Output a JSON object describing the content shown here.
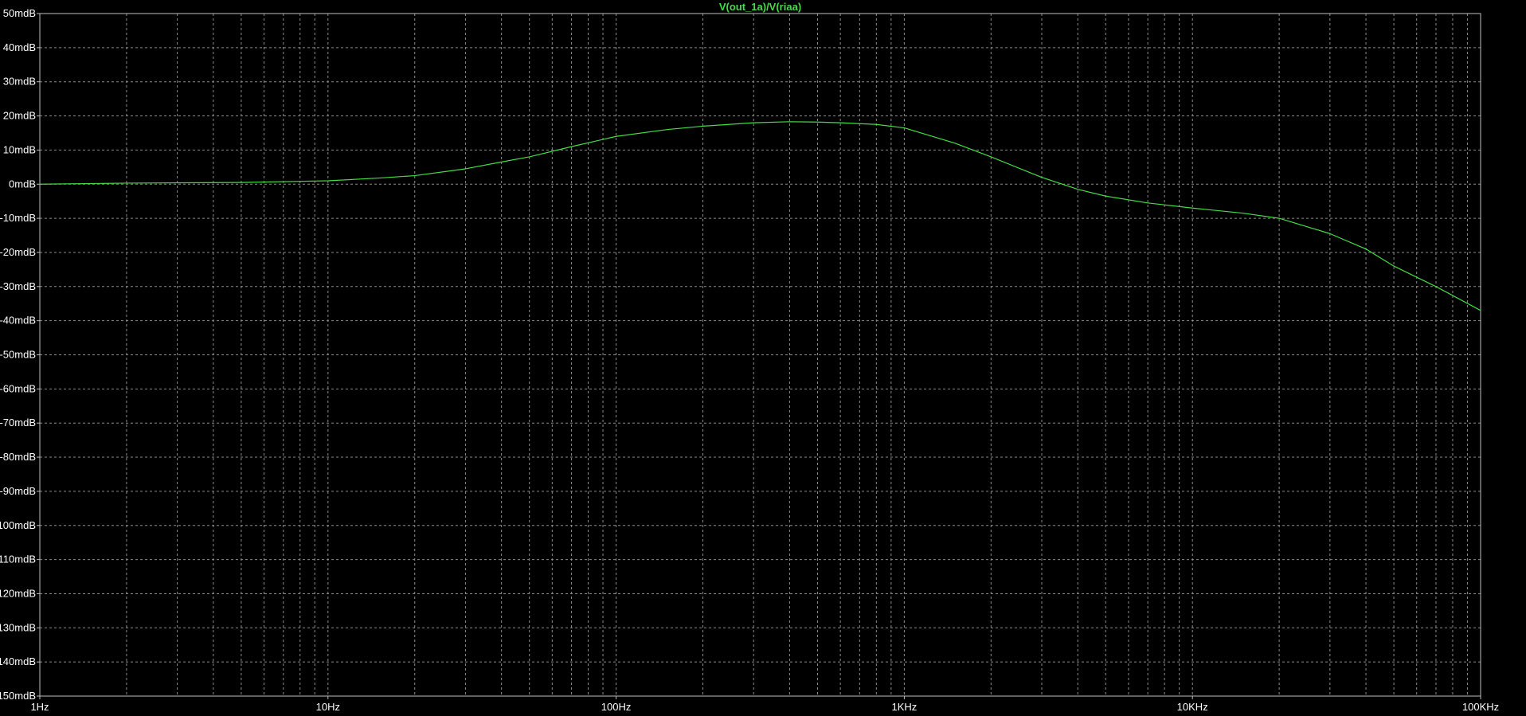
{
  "window": {
    "background": "#000000"
  },
  "chart_data": {
    "type": "line",
    "title": "V(out_1a)/V(riaa)",
    "xscale": "log",
    "xlim": [
      1,
      100000
    ],
    "ylim": [
      -150,
      50
    ],
    "grid": true,
    "xtick_values": [
      1,
      10,
      100,
      1000,
      10000,
      100000
    ],
    "xtick_labels": [
      "1Hz",
      "10Hz",
      "100Hz",
      "1KHz",
      "10KHz",
      "100KHz"
    ],
    "ytick_values": [
      50,
      40,
      30,
      20,
      10,
      0,
      -10,
      -20,
      -30,
      -40,
      -50,
      -60,
      -70,
      -80,
      -90,
      -100,
      -110,
      -120,
      -130,
      -140,
      -150
    ],
    "ytick_labels": [
      "50mdB",
      "40mdB",
      "30mdB",
      "20mdB",
      "10mdB",
      "0mdB",
      "-10mdB",
      "-20mdB",
      "-30mdB",
      "-40mdB",
      "-50mdB",
      "-60mdB",
      "-70mdB",
      "-80mdB",
      "-90mdB",
      "-100mdB",
      "-110mdB",
      "-120mdB",
      "-130mdB",
      "-140mdB",
      "-150mdB"
    ],
    "colors": {
      "line": "#44dd44",
      "grid": "#8c8c8c",
      "axis": "#bfbfbf",
      "tick_text": "#ffffff"
    },
    "series": [
      {
        "x": [
          1,
          2,
          5,
          10,
          15,
          20,
          30,
          40,
          50,
          70,
          100,
          150,
          200,
          300,
          400,
          500,
          600,
          800,
          1000,
          1500,
          2000,
          3000,
          4000,
          5000,
          7000,
          10000,
          15000,
          20000,
          30000,
          40000,
          50000,
          70000,
          100000
        ],
        "y": [
          0,
          0.3,
          0.5,
          1,
          1.8,
          2.5,
          4.5,
          6.5,
          8,
          11,
          14,
          16,
          17,
          18,
          18.3,
          18.2,
          18,
          17.5,
          16.5,
          12,
          8,
          2,
          -1.5,
          -3.5,
          -5.5,
          -7,
          -8.5,
          -10,
          -14.5,
          -19,
          -24,
          -30,
          -37
        ]
      }
    ]
  }
}
